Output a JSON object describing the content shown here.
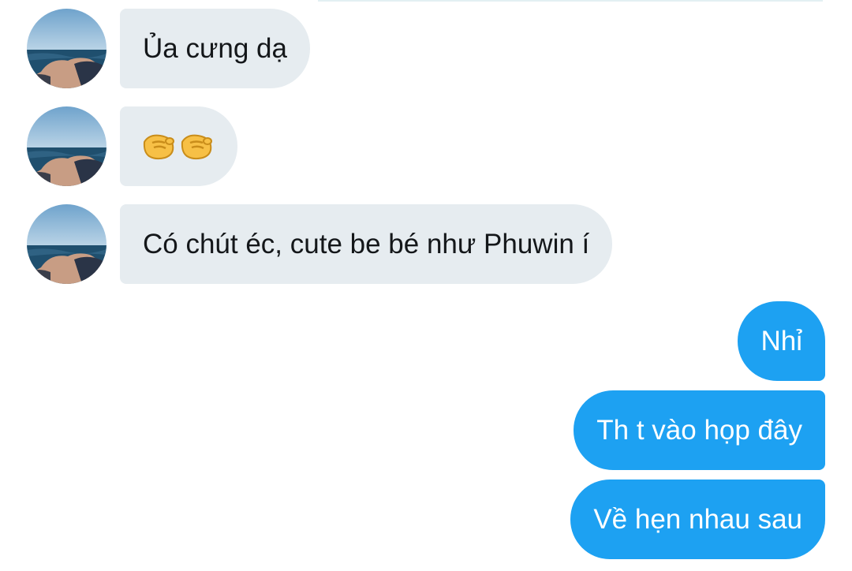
{
  "conversation": {
    "incoming": [
      {
        "text": "Ủa cưng dạ",
        "avatar_icon": "sea-hands-photo-avatar"
      },
      {
        "text": "",
        "emoji_icon": "pinching-hand-emoji",
        "emoji_count": 2,
        "avatar_icon": "sea-hands-photo-avatar"
      },
      {
        "text": "Có chút éc, cute be bé như Phuwin í",
        "avatar_icon": "sea-hands-photo-avatar"
      }
    ],
    "outgoing": [
      {
        "text": "Nhỉ"
      },
      {
        "text": "Th t vào họp đây"
      },
      {
        "text": "Về hẹn nhau sau"
      }
    ]
  },
  "colors": {
    "incoming_bubble": "#e6ecf0",
    "outgoing_bubble": "#1da1f2",
    "incoming_text": "#14171a",
    "outgoing_text": "#ffffff"
  }
}
